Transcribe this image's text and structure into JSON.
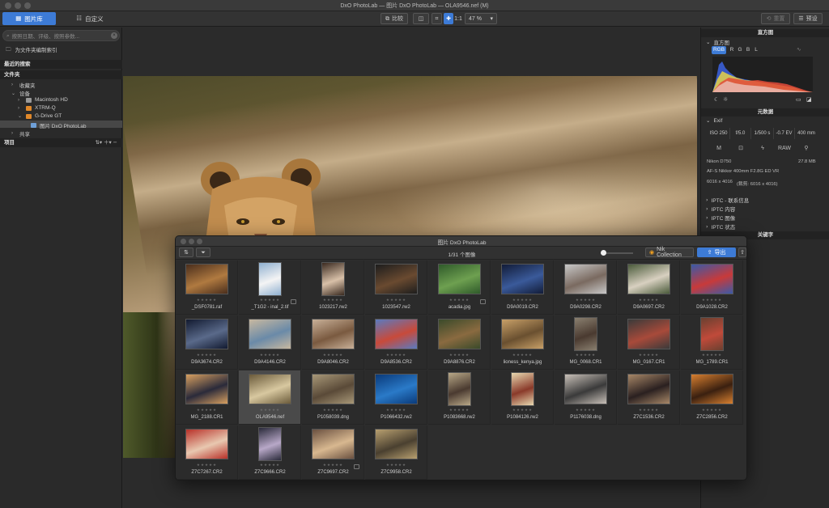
{
  "window": {
    "title": "DxO PhotoLab — 图片 DxO PhotoLab — OLA9546.nef (M)"
  },
  "toolbar": {
    "tab_library": "图片库",
    "tab_customize": "自定义",
    "compare": "比较",
    "ratio": "1:1",
    "zoom": "47 %",
    "reset": "重置",
    "preset": "预设"
  },
  "left": {
    "search_placeholder": "按照日期、评级、按照参数...",
    "index_label": "为文件夹编制索引",
    "recent_search": "最近的搜索",
    "folders": "文件夹",
    "tree": [
      {
        "label": "收藏夹"
      },
      {
        "label": "设备"
      },
      {
        "label": "Macintosh HD"
      },
      {
        "label": "XTRM-Q"
      },
      {
        "label": "G-Drive GT"
      },
      {
        "label": "图片 DxO PhotoLab"
      },
      {
        "label": "共享"
      }
    ],
    "projects": "项目"
  },
  "right": {
    "histogram": "直方图",
    "channels": [
      "RGB",
      "R",
      "G",
      "B",
      "L"
    ],
    "metadata": "元数据",
    "exif": "Exif",
    "exif_values": [
      "ISO 250",
      "f/5.0",
      "1/500 s",
      "-0.7 EV",
      "400 mm"
    ],
    "exif_icons": [
      "M",
      "RAW"
    ],
    "camera": "Nikon D750",
    "filesize": "27.8 MB",
    "lens": "AF-S Nikkor 400mm F2.8G ED VR",
    "dimensions": "6016 x 4016",
    "dimensions_crop": "(裁剪: 6016 x 4016)",
    "iptc": [
      "IPTC - 联系信息",
      "IPTC 内容",
      "IPTC 图像",
      "IPTC 状态"
    ],
    "keywords": "关键字"
  },
  "library": {
    "title": "图片 DxO PhotoLab",
    "count": "1/31 个图像",
    "nik": "Nik Collection",
    "export": "导出",
    "stars": "★★★★★",
    "items": [
      {
        "name": "_DSF0781.raf"
      },
      {
        "name": "_T1G2 - inal_2.tif"
      },
      {
        "name": "1023217.rw2"
      },
      {
        "name": "1023547.rw2"
      },
      {
        "name": "acadia.jpg"
      },
      {
        "name": "D9A0019.CR2"
      },
      {
        "name": "D9A0298.CR2"
      },
      {
        "name": "D9A0697.CR2"
      },
      {
        "name": "D9A1028.CR2"
      },
      {
        "name": "D9A3674.CR2"
      },
      {
        "name": "D9A4146.CR2"
      },
      {
        "name": "D9A8046.CR2"
      },
      {
        "name": "D9A8536.CR2"
      },
      {
        "name": "D9A8876.CR2"
      },
      {
        "name": "lioness_kenya.jpg"
      },
      {
        "name": "MG_0068.CR1"
      },
      {
        "name": "MG_0167.CR1"
      },
      {
        "name": "MG_1789.CR1"
      },
      {
        "name": "MG_2188.CR1"
      },
      {
        "name": "OLA9546.nef"
      },
      {
        "name": "P1058039.dng"
      },
      {
        "name": "P1066432.rw2"
      },
      {
        "name": "P1083668.rw2"
      },
      {
        "name": "P1084126.rw2"
      },
      {
        "name": "P1176038.dng"
      },
      {
        "name": "Z7C1536.CR2"
      },
      {
        "name": "Z7C2856.CR2"
      },
      {
        "name": "Z7C7267.CR2"
      },
      {
        "name": "Z7C9666.CR2"
      },
      {
        "name": "Z7C9697.CR2"
      },
      {
        "name": "Z7C9958.CR2"
      }
    ]
  }
}
